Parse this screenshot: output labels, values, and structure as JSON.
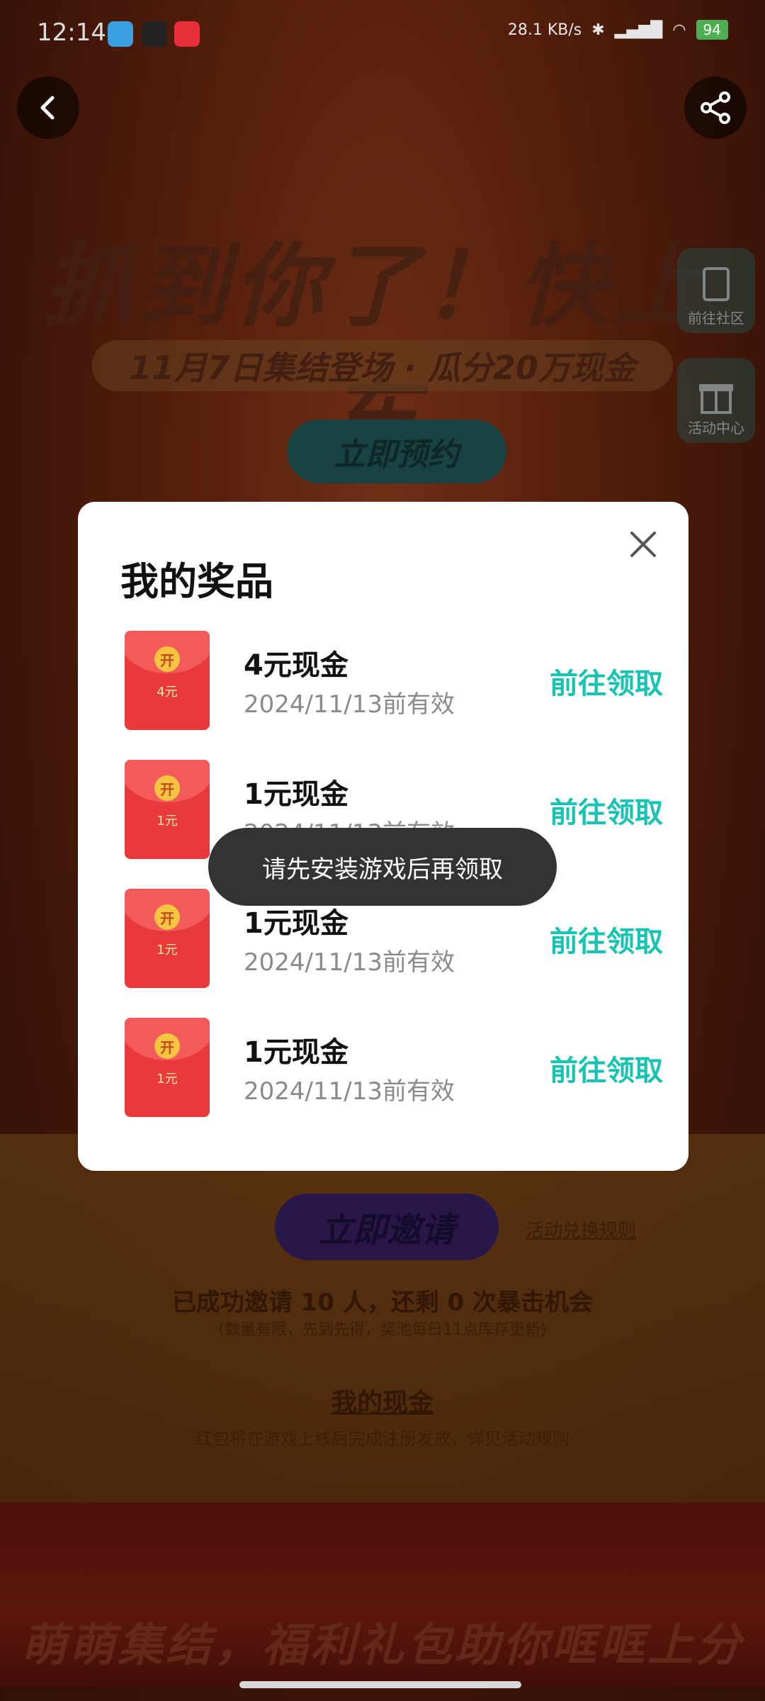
{
  "status_bar": {
    "time": "12:14",
    "net_speed": "28.1 KB/s",
    "battery": "94",
    "app_icons": [
      "telegram-icon",
      "dewu-icon",
      "xiaohongshu-icon"
    ]
  },
  "background": {
    "hero_title": "抓到你了！快上车",
    "hero_subtitle": "11月7日集结登场 · 瓜分20万现金",
    "reserve_button": "立即预约",
    "side_links": [
      {
        "label": "前往社区",
        "icon": "community-icon"
      },
      {
        "label": "活动中心",
        "icon": "gift-icon"
      }
    ],
    "invite_button": "立即邀请",
    "rules_link": "活动兑换规则",
    "invite_status": "已成功邀请 10 人，还剩 0 次暴击机会",
    "invite_note": "(数量有限，先到先得，奖池每日11点库存更新)",
    "cash_title": "我的现金",
    "cash_note": "红包将在游戏上线后完成注册发放，详见活动规则",
    "bottom_slogan": "萌萌集结，福利礼包助你哐哐上分"
  },
  "modal": {
    "title": "我的奖品",
    "prizes": [
      {
        "name": "4元现金",
        "valid": "2024/11/13前有效",
        "claim": "前往领取",
        "envelope_coin": "开",
        "envelope_amount": "4元"
      },
      {
        "name": "1元现金",
        "valid": "2024/11/13前有效",
        "claim": "前往领取",
        "envelope_coin": "开",
        "envelope_amount": "1元"
      },
      {
        "name": "1元现金",
        "valid": "2024/11/13前有效",
        "claim": "前往领取",
        "envelope_coin": "开",
        "envelope_amount": "1元"
      },
      {
        "name": "1元现金",
        "valid": "2024/11/13前有效",
        "claim": "前往领取",
        "envelope_coin": "开",
        "envelope_amount": "1元"
      }
    ]
  },
  "toast": {
    "text": "请先安装游戏后再领取"
  },
  "colors": {
    "accent": "#17c3b2",
    "envelope": "#e83a3a",
    "toast_bg": "#333333"
  }
}
